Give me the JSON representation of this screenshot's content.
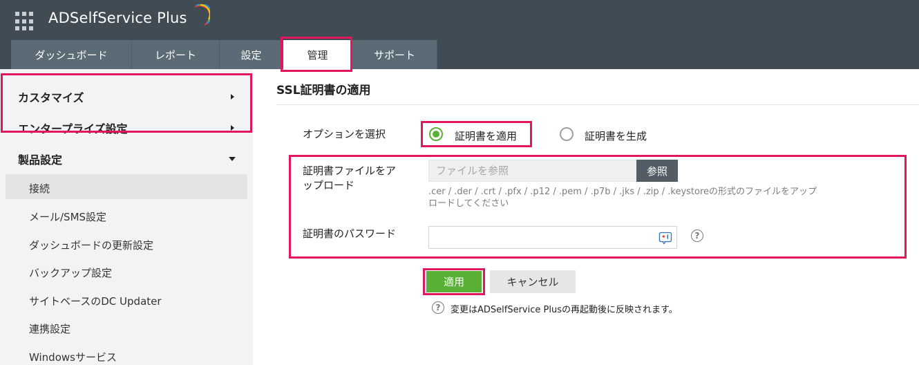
{
  "header": {
    "app_title": "ADSelfService Plus",
    "tabs": [
      {
        "label": "ダッシュボード",
        "active": false
      },
      {
        "label": "レポート",
        "active": false
      },
      {
        "label": "設定",
        "active": false
      },
      {
        "label": "管理",
        "active": true
      },
      {
        "label": "サポート",
        "active": false
      }
    ]
  },
  "sidebar": {
    "sections": [
      {
        "label": "カスタマイズ",
        "expanded": false
      },
      {
        "label": "エンタープライズ設定",
        "expanded": false
      },
      {
        "label": "製品設定",
        "expanded": true
      }
    ],
    "items": [
      {
        "label": "接続",
        "selected": true
      },
      {
        "label": "メール/SMS設定"
      },
      {
        "label": "ダッシュボードの更新設定"
      },
      {
        "label": "バックアップ設定"
      },
      {
        "label": "サイトベースのDC Updater"
      },
      {
        "label": "連携設定"
      },
      {
        "label": "Windowsサービス"
      }
    ]
  },
  "main": {
    "title": "SSL証明書の適用",
    "option_label": "オプションを選択",
    "options": [
      {
        "label": "証明書を適用",
        "selected": true
      },
      {
        "label": "証明書を生成",
        "selected": false
      }
    ],
    "upload_label_line1": "証明書ファイルをア",
    "upload_label_line2": "ップロード",
    "file_placeholder": "ファイルを参照",
    "browse_label": "参照",
    "hint_line1": ".cer / .der / .crt / .pfx / .p12 / .pem / .p7b / .jks / .zip / .keystoreの形式のファイルをアップ",
    "hint_line2": "ロードしてください",
    "password_label": "証明書のパスワード",
    "password_value": "",
    "help_glyph": "?",
    "apply_label": "適用",
    "cancel_label": "キャンセル",
    "note": "変更はADSelfService Plusの再起動後に反映されます。"
  },
  "colors": {
    "header_bg": "#414b53",
    "tab_bg": "#5a6b75",
    "accent_green": "#5ab036",
    "highlight": "#e0165f"
  }
}
